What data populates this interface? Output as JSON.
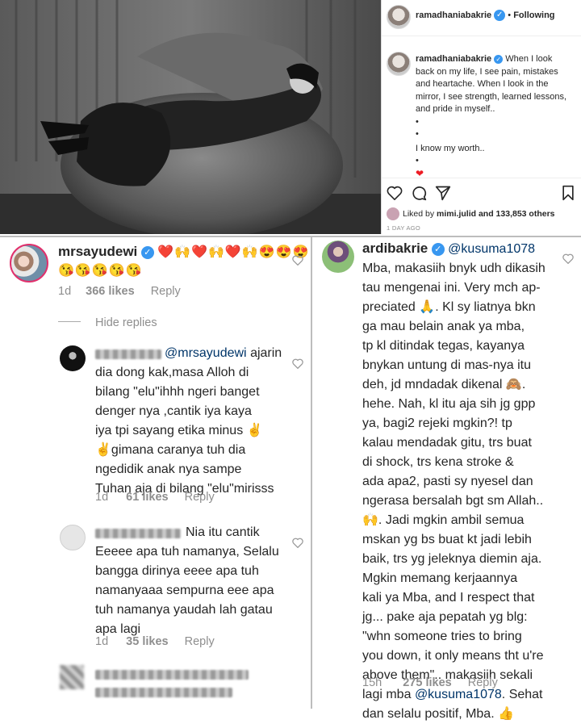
{
  "post": {
    "username": "ramadhaniabakrie",
    "dot": "•",
    "follow_status": "Following",
    "caption_lines": [
      "When I look",
      "back on my life, I see pain, mistakes",
      "and heartache. When I look in the",
      "mirror, I see strength, learned lessons,",
      "and pride in myself.."
    ],
    "dots": [
      "•",
      "•",
      "•"
    ],
    "caption_end": "I know my worth..",
    "heart": "❤",
    "liked_by_prefix": "Liked by",
    "liked_by_user": "mimi.julid",
    "liked_by_suffix": "and 133,853 others",
    "time": "1 DAY AGO"
  },
  "left_comments": {
    "main": {
      "username": "mrsayudewi",
      "emojis_line1": "❤️🙌❤️🙌❤️🙌😍😍😍",
      "emojis_line2": "😘😘😘😘😘",
      "age": "1d",
      "likes": "366 likes",
      "reply": "Reply",
      "hide_replies": "Hide replies"
    },
    "reply1": {
      "mention": "@mrsayudewi",
      "lines": [
        "ajarin",
        "dia dong kak,masa Alloh di",
        "bilang \"elu\"ihhh ngeri banget",
        "denger nya ,cantik iya kaya",
        "iya tpi sayang etika minus ✌",
        "✌gimana caranya tuh dia",
        "ngedidik anak nya sampe",
        "Tuhan aja di bilang \"elu\"mirisss"
      ],
      "age": "1d",
      "likes": "61 likes",
      "reply": "Reply"
    },
    "reply2": {
      "lines": [
        "Nia itu cantik",
        "Eeeee apa tuh namanya, Selalu",
        "bangga dirinya eeee apa tuh",
        "namanyaaa sempurna eee apa",
        "tuh namanya yaudah lah gatau",
        "apa lagi"
      ],
      "age": "1d",
      "likes": "35 likes",
      "reply": "Reply"
    }
  },
  "right_comment": {
    "username": "ardibakrie",
    "mention": "@kusuma1078",
    "lines": [
      "Mba, makasiih bnyk udh dikasih",
      "tau mengenai ini. Very mch ap-",
      "preciated 🙏. Kl sy liatnya bkn",
      "ga mau belain anak ya mba,",
      "tp kl ditindak tegas, kayanya",
      "bnykan untung di mas-nya itu",
      "deh, jd mndadak dikenal 🙈.",
      "hehe. Nah, kl itu aja sih jg gpp",
      "ya, bagi2 rejeki mgkin?! tp",
      "kalau mendadak gitu, trs buat",
      "di shock, trs kena stroke &",
      "ada apa2, pasti sy nyesel dan",
      "ngerasa bersalah bgt sm Allah..",
      "🙌. Jadi mgkin ambil semua",
      "mskan yg bs buat kt jadi lebih",
      "baik, trs yg jeleknya diemin aja.",
      "Mgkin memang kerjaannya",
      "kali ya Mba, and I respect that",
      "jg... pake aja pepatah yg blg:",
      "\"whn someone tries to bring",
      "you down, it only means tht u're",
      "above them\".. makasiih sekali",
      "lagi mba"
    ],
    "mention_end": "@kusuma1078",
    "tail_1": ". Sehat",
    "last_line": "dan selalu positif, Mba. 👍",
    "age": "15h",
    "likes": "275 likes",
    "reply": "Reply"
  }
}
